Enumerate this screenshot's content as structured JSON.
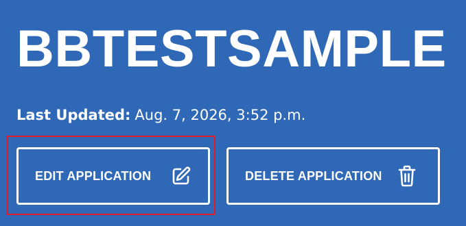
{
  "page": {
    "title": "BBTESTSAMPLE",
    "last_updated_label": "Last Updated:",
    "last_updated_value": "Aug. 7, 2026, 3:52 p.m."
  },
  "actions": {
    "edit_label": "EDIT APPLICATION",
    "edit_icon": "edit-icon",
    "delete_label": "DELETE APPLICATION",
    "delete_icon": "trash-icon"
  },
  "colors": {
    "background": "#2f68b6",
    "text": "#ffffff",
    "highlight": "#e11b22"
  }
}
